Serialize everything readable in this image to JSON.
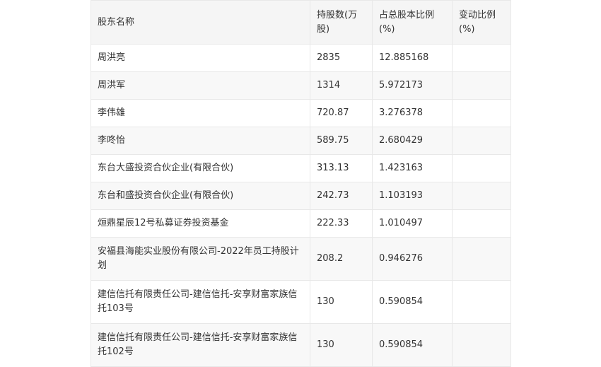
{
  "table": {
    "headers": [
      "股东名称",
      "持股数(万股)",
      "占总股本比例(%)",
      "变动比例(%)"
    ],
    "rows": [
      [
        "周洪亮",
        "2835",
        "12.885168",
        ""
      ],
      [
        "周洪军",
        "1314",
        "5.972173",
        ""
      ],
      [
        "李伟雄",
        "720.87",
        "3.276378",
        ""
      ],
      [
        "李咚怡",
        "589.75",
        "2.680429",
        ""
      ],
      [
        "东台大盛投资合伙企业(有限合伙)",
        "313.13",
        "1.423163",
        ""
      ],
      [
        "东台和盛投资合伙企业(有限合伙)",
        "242.73",
        "1.103193",
        ""
      ],
      [
        "烜鼎星辰12号私募证券投资基金",
        "222.33",
        "1.010497",
        ""
      ],
      [
        "安福县海能实业股份有限公司-2022年员工持股计划",
        "208.2",
        "0.946276",
        ""
      ],
      [
        "建信信托有限责任公司-建信信托-安享财富家族信托103号",
        "130",
        "0.590854",
        ""
      ],
      [
        "建信信托有限责任公司-建信信托-安享财富家族信托102号",
        "130",
        "0.590854",
        ""
      ]
    ]
  }
}
